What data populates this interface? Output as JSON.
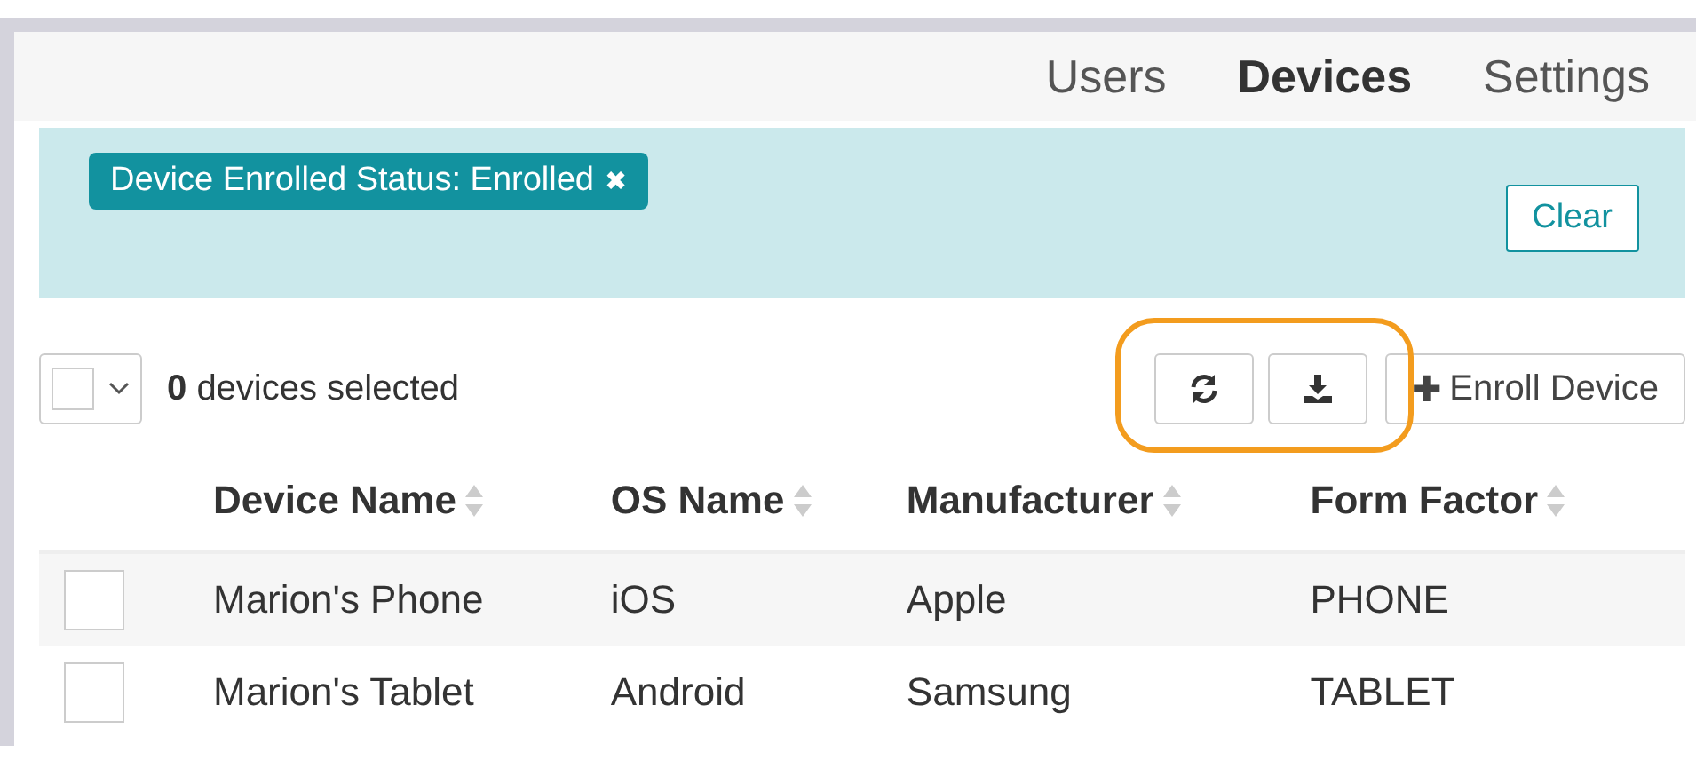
{
  "tabs": [
    {
      "label": "Users",
      "selected": false
    },
    {
      "label": "Devices",
      "selected": true
    },
    {
      "label": "Settings",
      "selected": false
    }
  ],
  "filter": {
    "chips": [
      {
        "label": "Device Enrolled Status: Enrolled",
        "remove": "✖"
      }
    ],
    "clear_button": "Clear"
  },
  "toolbar": {
    "select_all": {
      "checked": false
    },
    "selection_count": "0",
    "selection_text": "devices selected",
    "highlight": true,
    "icon_buttons": [
      {
        "kind": "refresh"
      },
      {
        "kind": "download"
      }
    ],
    "enroll_button": {
      "icon": "✚",
      "label": "Enroll Device"
    }
  },
  "table": {
    "columns": [
      "Device Name",
      "OS Name",
      "Manufacturer",
      "Form Factor"
    ],
    "rows": [
      {
        "checked": false,
        "cells": [
          "Marion's Phone",
          "iOS",
          "Apple",
          "PHONE"
        ]
      },
      {
        "checked": false,
        "cells": [
          "Marion's Tablet",
          "Android",
          "Samsung",
          "TABLET"
        ]
      }
    ]
  }
}
